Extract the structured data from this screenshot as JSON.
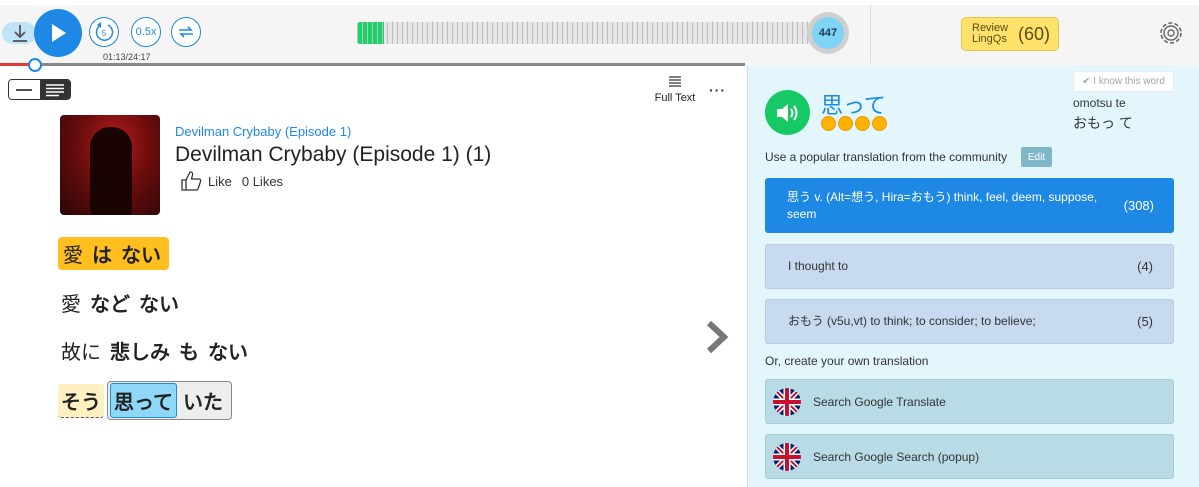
{
  "player": {
    "time": "01:13/24:17",
    "rewind_label": "5",
    "speed_label": "0.5x",
    "meter_count": "447",
    "meter_fill_fraction": 0.06,
    "playback_fraction": 0.05
  },
  "review": {
    "label": "Review LingQs",
    "count": "(60)"
  },
  "toolbar": {
    "full_text": "Full Text",
    "more": "···"
  },
  "lesson": {
    "course": "Devilman Crybaby (Episode 1)",
    "title": "Devilman Crybaby (Episode 1) (1)",
    "like_label": "Like",
    "likes": "0 Likes"
  },
  "text": {
    "line1": [
      "愛",
      "は",
      "ない"
    ],
    "line2": [
      "愛",
      "など",
      "ない"
    ],
    "line3": [
      "故に",
      "悲しみ",
      "も",
      "ない"
    ],
    "line4": [
      "そう",
      "思って",
      "いた"
    ]
  },
  "sidebar": {
    "know_button": "✔ I know this word",
    "term": "思って",
    "romaji": "omotsu te",
    "reading": "おもっ て",
    "community_label": "Use a popular translation from the community",
    "edit": "Edit",
    "hints": [
      {
        "text": "思う v. (Alt=想う, Hira=おもう) think, feel, deem, suppose, seem",
        "count": "(308)"
      },
      {
        "text": "I thought to",
        "count": "(4)"
      },
      {
        "text": "おもう (v5u,vt) to think; to consider; to believe;",
        "count": "(5)"
      }
    ],
    "own_label": "Or, create your own translation",
    "search_google_translate": "Search Google Translate",
    "search_google_search": "Search Google Search (popup)"
  },
  "colors": {
    "accent": "#1e88e5",
    "known_green": "#17c964",
    "lingq_yellow": "#ffbf1f",
    "review_yellow": "#ffe26a"
  }
}
